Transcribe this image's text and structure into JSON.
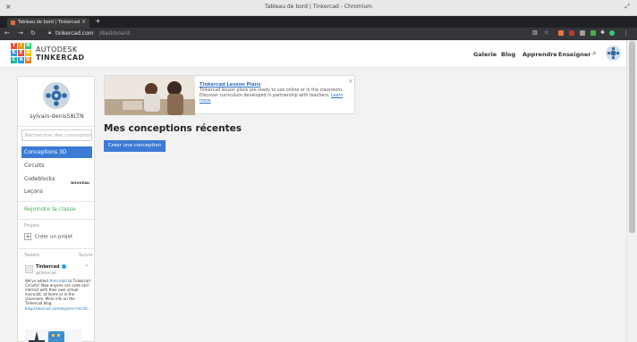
{
  "browser": {
    "window_title": "Tableau de bord | Tinkercad - Chromium",
    "tab_title": "Tableau de bord | Tinkercad",
    "url_host": "tinkercad.com",
    "url_path": "/dashboard"
  },
  "site": {
    "logo_letters": [
      "T",
      "I",
      "N",
      "K",
      "E",
      "R",
      "C",
      "A",
      "D"
    ],
    "logo_line1": "AUTODESK",
    "logo_line2": "TINKERCAD",
    "nav": {
      "galerie": "Galerie",
      "blog": "Blog",
      "apprendre": "Apprendre",
      "enseigner": "Enseigner"
    }
  },
  "sidebar": {
    "username": "sylvain-denis58LTN",
    "search_placeholder": "Rechercher des conceptions",
    "items": [
      {
        "label": "Conceptions 3D",
        "active": true
      },
      {
        "label": "Circuits"
      },
      {
        "label": "Codeblocks",
        "badge": "NOUVEAU"
      },
      {
        "label": "Leçons"
      }
    ],
    "join_class": "Rejoindre la classe",
    "projects_heading": "Projets",
    "create_project": "Créer un projet",
    "tweets_heading": "Tweets",
    "follow": "Suivre",
    "tweet": {
      "name": "Tinkercad",
      "handle": "@tinkercad",
      "text_before": "We've added ",
      "text_hashtag": "#microbit",
      "text_after": " to Tinkercad Circuits! Now anyone can code and interact with their own virtual micro:bit, at home or in the classroom. More info on the Tinkercad blog:",
      "link": "blog.tinkercad.com/explore-microb..."
    }
  },
  "main": {
    "lesson": {
      "title": "Tinkercad Lesson Plans",
      "desc": "Tinkercad lesson plans are ready to use online or in the classroom. Discover curriculum developed in partnership with teachers.",
      "learn_more": "Learn more"
    },
    "recent_title": "Mes conceptions récentes",
    "create_button": "Créer une conception"
  },
  "colors": {
    "accent": "#3d7ad6",
    "join_class": "#4caf50",
    "logo": [
      "#e94c3d",
      "#f39c12",
      "#2ecc71",
      "#3498db",
      "#e94c3d",
      "#f1c40f",
      "#1abc9c",
      "#3498db",
      "#e67e22"
    ]
  }
}
